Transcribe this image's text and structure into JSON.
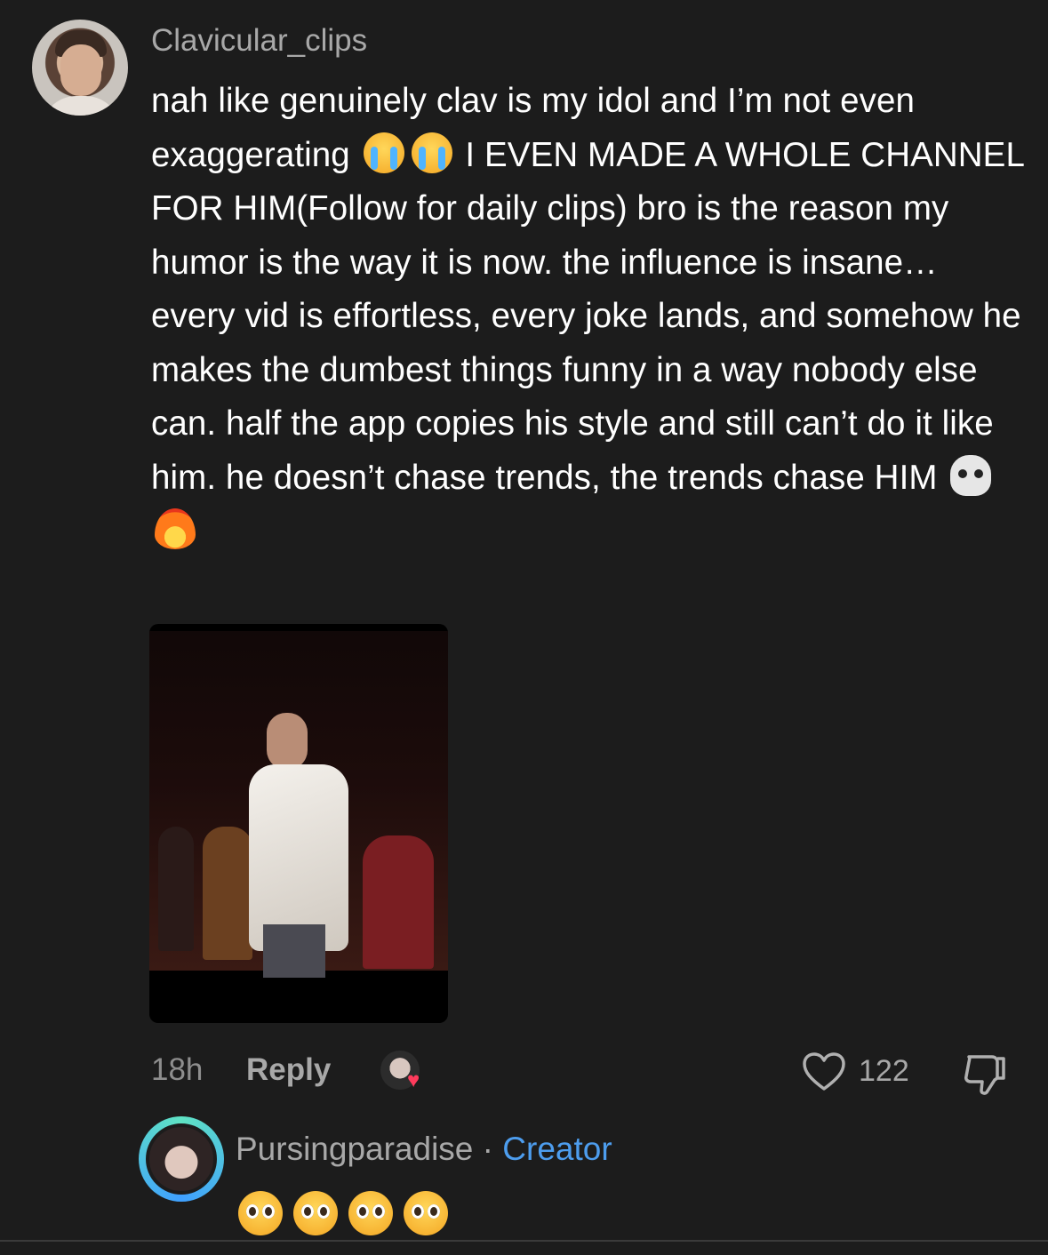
{
  "comment": {
    "username": "Clavicular_clips",
    "text_part1": "nah like genuinely clav is my idol and I’m not even exaggerating",
    "emoji_1": "😭",
    "emoji_2": "😭",
    "text_part2": "I EVEN MADE A WHOLE CHANNEL FOR HIM(Follow for daily clips) bro is the reason my humor is the way it is now. the influence is insane… every vid is effortless, every joke lands, and somehow he makes the dumbest things funny in a way nobody else can. half the app copies his style and still can’t do it like him. he doesn’t chase trends, the trends chase HIM",
    "emoji_3": "💀",
    "emoji_4": "🔥",
    "time": "18h",
    "reply_label": "Reply",
    "like_count": "122",
    "liked_by_creator": true
  },
  "reply": {
    "username": "Pursingparadise",
    "separator": "·",
    "badge": "Creator",
    "emojis": [
      "🥺",
      "🥺",
      "🥺",
      "🥺"
    ]
  },
  "colors": {
    "background": "#1c1c1c",
    "secondary_text": "#a8a8a8",
    "creator_badge": "#4d9dee",
    "heart": "#ff3b5c"
  },
  "icons": {
    "like": "heart-outline-icon",
    "dislike": "thumbs-down-icon",
    "creator_liked": "heart-icon"
  }
}
